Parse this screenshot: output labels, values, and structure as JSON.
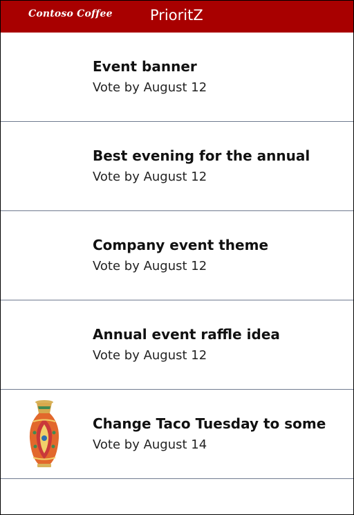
{
  "header": {
    "brand": "Contoso Coffee",
    "title": "PrioritZ"
  },
  "items": [
    {
      "title": "Event banner",
      "subtitle": "Vote by August 12",
      "image": ""
    },
    {
      "title": "Best evening for the annual",
      "subtitle": "Vote by August 12",
      "image": ""
    },
    {
      "title": "Company event theme",
      "subtitle": "Vote by August 12",
      "image": ""
    },
    {
      "title": "Annual event raffle idea",
      "subtitle": "Vote by August 12",
      "image": ""
    },
    {
      "title": "Change Taco Tuesday to some",
      "subtitle": "Vote by August 14",
      "image": "vase-image"
    }
  ],
  "colors": {
    "header_bg": "#a80000",
    "divider": "#6f7a8f"
  }
}
